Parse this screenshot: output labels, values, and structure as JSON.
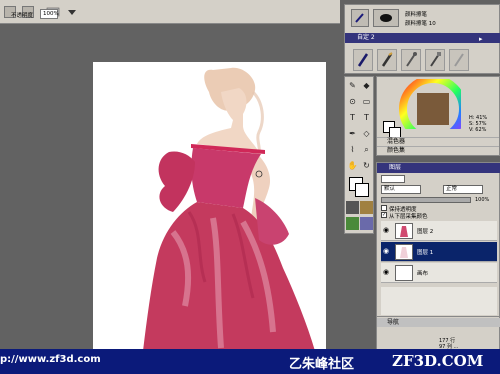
{
  "topbar": {
    "opacity_label": "不透明度",
    "opacity_value": "100%"
  },
  "brush_panel": {
    "brush_name_line1": "颜料擦笔",
    "brush_name_line2": "颜料擦笔 10",
    "tab_label": "自定 2"
  },
  "color_panel": {
    "readout_h": "H: 41%",
    "readout_s": "S: 57%",
    "readout_v": "V: 62%",
    "section_mix": "混色器",
    "section_sample": "颜色集"
  },
  "layers_panel": {
    "title": "图层",
    "blend_mode": "默认",
    "composite": "正常",
    "opacity_value": "100%",
    "check_preserve": "保持透明度",
    "check_sample": "从下层采集颜色",
    "layers": [
      {
        "name": "图层 2",
        "selected": false
      },
      {
        "name": "图层 1",
        "selected": true
      },
      {
        "name": "画布",
        "selected": false
      }
    ]
  },
  "navigator": {
    "title": "导航",
    "line1": "177 行",
    "line2": "97 列 ..."
  },
  "watermark": {
    "url": "p://www.zf3d.com",
    "cn_name": "乙朱峰社区",
    "site": "ZF3D.COM"
  },
  "colors": {
    "dress": "#c43a5e",
    "title_bar": "#34347c",
    "banner": "#0b1a7a",
    "panel": "#d4d0c8"
  }
}
